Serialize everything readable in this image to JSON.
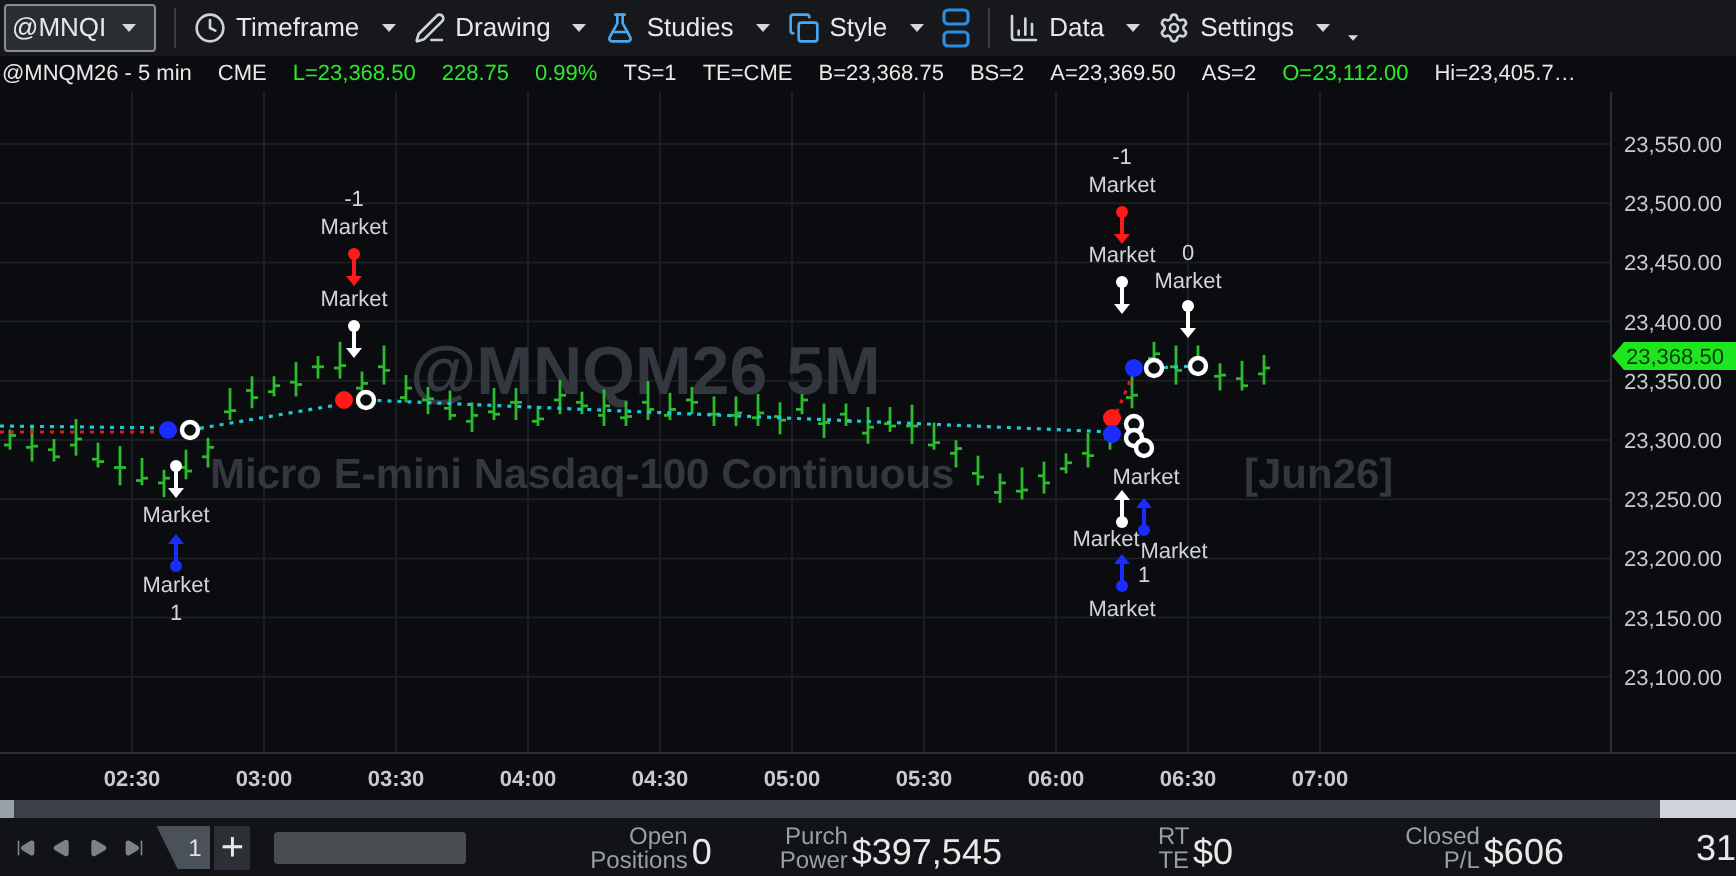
{
  "toolbar": {
    "symbol": "@MNQI",
    "menus": [
      {
        "label": "Timeframe"
      },
      {
        "label": "Drawing"
      },
      {
        "label": "Studies"
      },
      {
        "label": "Style"
      },
      {
        "label": "Data"
      },
      {
        "label": "Settings"
      }
    ]
  },
  "quote_line": [
    {
      "text": "@MNQM26 - 5 min",
      "color": "#e8e8e8"
    },
    {
      "text": "CME",
      "color": "#e8e8e8"
    },
    {
      "text": "L=23,368.50",
      "color": "#2ee82e"
    },
    {
      "text": "228.75",
      "color": "#2ee82e"
    },
    {
      "text": "0.99%",
      "color": "#2ee82e"
    },
    {
      "text": "TS=1",
      "color": "#e8e8e8"
    },
    {
      "text": "TE=CME",
      "color": "#e8e8e8"
    },
    {
      "text": "B=23,368.75",
      "color": "#e8e8e8"
    },
    {
      "text": "BS=2",
      "color": "#e8e8e8"
    },
    {
      "text": "A=23,369.50",
      "color": "#e8e8e8"
    },
    {
      "text": "AS=2",
      "color": "#e8e8e8"
    },
    {
      "text": "O=23,112.00",
      "color": "#2ee82e"
    },
    {
      "text": "Hi=23,405.7…",
      "color": "#e8e8e8"
    }
  ],
  "chart": {
    "watermark_symbol": "@MNQM26 5M",
    "watermark_name_parts": [
      "Micro E-mini Nasdaq-100 Continuous",
      "[Jun26]"
    ],
    "price_labels": [
      "23,550.00",
      "23,500.00",
      "23,450.00",
      "23,400.00",
      "23,350.00",
      "23,300.00",
      "23,250.00",
      "23,200.00",
      "23,150.00",
      "23,100.00"
    ],
    "time_labels": [
      "02:30",
      "03:00",
      "03:30",
      "04:00",
      "04:30",
      "05:00",
      "05:30",
      "06:00",
      "06:30",
      "07:00"
    ],
    "last_price": "23,368.50",
    "order_labels": [
      "Market",
      "Market",
      "1",
      "-1",
      "Market",
      "Market",
      "-1",
      "Market",
      "Market",
      "0",
      "Market",
      "Market",
      "Market",
      "Market",
      "1",
      "Market"
    ]
  },
  "bottom_bar": {
    "tab": "1",
    "add": "+",
    "stats": [
      {
        "label": "Open Positions",
        "value": "0"
      },
      {
        "label": "Purch Power",
        "value": "$397,545"
      },
      {
        "label": "RT TE",
        "value": "$0"
      },
      {
        "label": "Closed P/L",
        "value": "$606"
      },
      {
        "value": "31"
      }
    ]
  }
}
